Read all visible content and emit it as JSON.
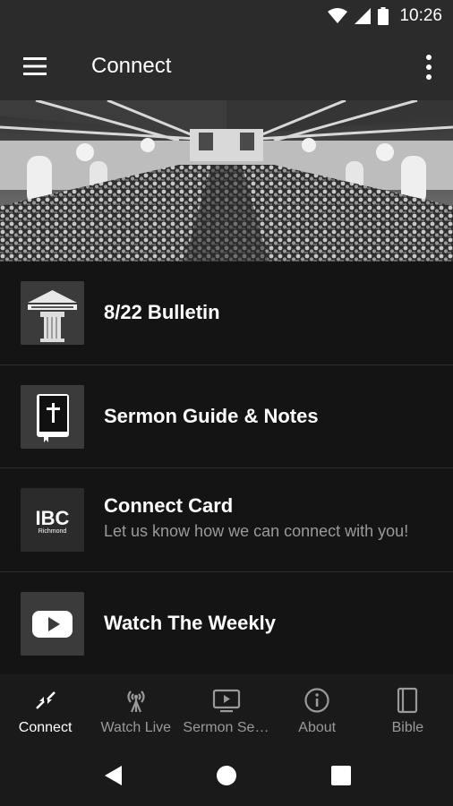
{
  "status_bar": {
    "time": "10:26",
    "icons": [
      "wifi-icon",
      "cell-signal-icon",
      "battery-icon"
    ]
  },
  "app_bar": {
    "title": "Connect",
    "menu_icon": "hamburger-menu-icon",
    "more_icon": "more-vertical-icon"
  },
  "hero": {
    "icon": "church-sanctuary-photo"
  },
  "list": {
    "items": [
      {
        "title": "8/22 Bulletin",
        "subtitle": "",
        "icon": "church-columns-icon"
      },
      {
        "title": "Sermon Guide & Notes",
        "subtitle": "",
        "icon": "bible-book-icon"
      },
      {
        "title": "Connect Card",
        "subtitle": "Let us know how we can connect with you!",
        "icon": "ibc-logo",
        "logo_text": "IBC",
        "logo_subtext": "Richmond"
      },
      {
        "title": "Watch The Weekly",
        "subtitle": "",
        "icon": "youtube-play-icon"
      }
    ]
  },
  "bottom_nav": {
    "items": [
      {
        "label": "Connect",
        "icon": "connect-arrows-icon",
        "active": true
      },
      {
        "label": "Watch Live",
        "icon": "broadcast-antenna-icon",
        "active": false
      },
      {
        "label": "Sermon Series",
        "icon": "tv-play-icon",
        "active": false
      },
      {
        "label": "About",
        "icon": "info-icon",
        "active": false
      },
      {
        "label": "Bible",
        "icon": "book-icon",
        "active": false
      }
    ]
  },
  "system_nav": {
    "icons": [
      "back-icon",
      "home-icon",
      "recents-icon"
    ]
  },
  "colors": {
    "app_bar": "#2b2b2b",
    "background": "#141414",
    "active_nav": "#ffffff",
    "inactive_nav": "#9a9a9a"
  }
}
